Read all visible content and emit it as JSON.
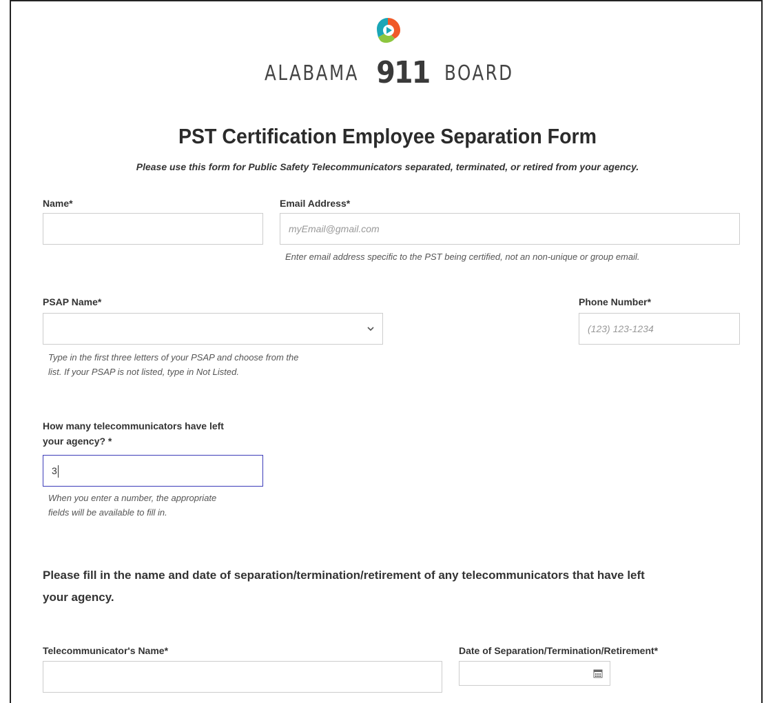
{
  "logo": {
    "word_left": "ALABAMA",
    "number": "911",
    "word_right": "BOARD",
    "colors": {
      "orange": "#f05a28",
      "teal": "#1aa6b7",
      "green": "#8dc63f",
      "dark": "#3a3a3a"
    }
  },
  "form": {
    "title": "PST Certification Employee Separation Form",
    "subtitle": "Please use this form for Public Safety Telecommunicators separated, terminated, or retired from your agency.",
    "name": {
      "label": "Name*",
      "value": ""
    },
    "email": {
      "label": "Email Address*",
      "placeholder": "myEmail@gmail.com",
      "help": "Enter email address specific to the PST being certified, not an non-unique or group email."
    },
    "psap": {
      "label": "PSAP Name*",
      "value": "",
      "help_line1": "Type in the first three letters of your PSAP and choose from the",
      "help_line2": "list. If your PSAP is not listed, type in Not Listed."
    },
    "phone": {
      "label": "Phone Number*",
      "placeholder": "(123) 123-1234"
    },
    "count": {
      "label_line1": "How many telecommunicators have left",
      "label_line2": "your agency? *",
      "value": "3",
      "help_line1": "When you enter a number, the appropriate",
      "help_line2": "fields will be available to fill in."
    },
    "section": {
      "line1": "Please fill in the name and date of separation/termination/retirement of any telecommunicators that have left",
      "line2": "your agency."
    },
    "telecommunicator": {
      "label": "Telecommunicator's Name*",
      "value": ""
    },
    "separation_date": {
      "label": "Date of Separation/Termination/Retirement*",
      "value": ""
    }
  },
  "colors": {
    "focus_border": "#3a3ab8",
    "input_border": "#cccccc",
    "frame_border": "#222222"
  }
}
